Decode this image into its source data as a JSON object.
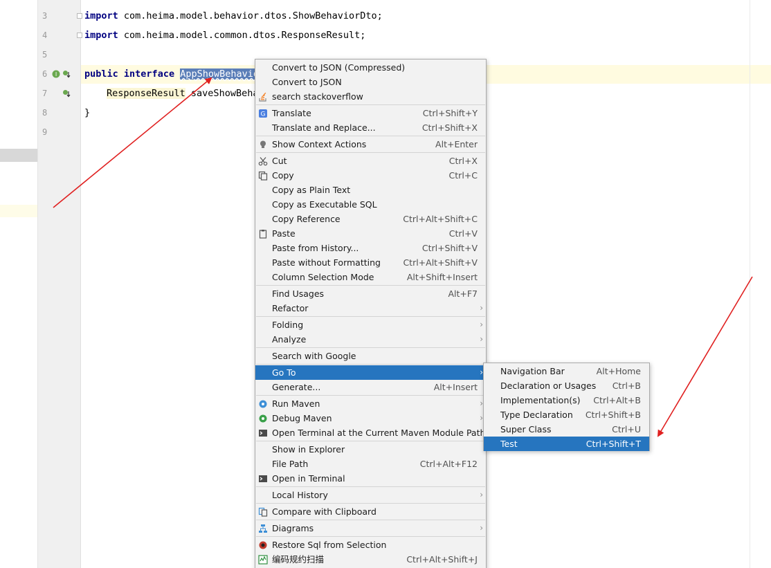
{
  "colors": {
    "keyword": "#000080",
    "selection": "#5b7eb8",
    "menu_active": "#2675bf",
    "annotation_arrow": "#e02020"
  },
  "gutter": {
    "line_numbers": [
      "3",
      "4",
      "5",
      "6",
      "7",
      "8",
      "9"
    ]
  },
  "editor": {
    "lines": {
      "l3": {
        "kw": "import",
        "rest": " com.heima.model.behavior.dtos.ShowBehaviorDto;"
      },
      "l4": {
        "kw": "import",
        "rest": " com.heima.model.common.dtos.ResponseResult;"
      },
      "l6": {
        "kw1": "public",
        "kw2": "interface",
        "name": "AppShowBehavio"
      },
      "l7": {
        "type": "ResponseResult",
        "rest": " saveShowBeha"
      },
      "l8": {
        "text": "}"
      }
    }
  },
  "context_menu": {
    "items": [
      {
        "label": "Convert to JSON (Compressed)",
        "shortcut": ""
      },
      {
        "label": "Convert to JSON",
        "shortcut": ""
      },
      {
        "label": "search stackoverflow",
        "shortcut": "",
        "icon": "stackoverflow-icon"
      },
      {
        "label": "Translate",
        "shortcut": "Ctrl+Shift+Y",
        "icon": "translate-icon"
      },
      {
        "label": "Translate and Replace...",
        "shortcut": "Ctrl+Shift+X"
      },
      {
        "label": "Show Context Actions",
        "shortcut": "Alt+Enter",
        "icon": "lightbulb-icon"
      },
      {
        "label": "Cut",
        "shortcut": "Ctrl+X",
        "icon": "scissors-icon"
      },
      {
        "label": "Copy",
        "shortcut": "Ctrl+C",
        "icon": "copy-icon"
      },
      {
        "label": "Copy as Plain Text",
        "shortcut": ""
      },
      {
        "label": "Copy as Executable SQL",
        "shortcut": ""
      },
      {
        "label": "Copy Reference",
        "shortcut": "Ctrl+Alt+Shift+C"
      },
      {
        "label": "Paste",
        "shortcut": "Ctrl+V",
        "icon": "clipboard-icon"
      },
      {
        "label": "Paste from History...",
        "shortcut": "Ctrl+Shift+V"
      },
      {
        "label": "Paste without Formatting",
        "shortcut": "Ctrl+Alt+Shift+V"
      },
      {
        "label": "Column Selection Mode",
        "shortcut": "Alt+Shift+Insert"
      },
      {
        "label": "Find Usages",
        "shortcut": "Alt+F7"
      },
      {
        "label": "Refactor",
        "shortcut": ""
      },
      {
        "label": "Folding",
        "shortcut": ""
      },
      {
        "label": "Analyze",
        "shortcut": ""
      },
      {
        "label": "Search with Google",
        "shortcut": ""
      },
      {
        "label": "Go To",
        "shortcut": ""
      },
      {
        "label": "Generate...",
        "shortcut": "Alt+Insert"
      },
      {
        "label": "Run Maven",
        "shortcut": "",
        "icon": "gear-run-icon"
      },
      {
        "label": "Debug Maven",
        "shortcut": "",
        "icon": "gear-debug-icon"
      },
      {
        "label": "Open Terminal at the Current Maven Module Path",
        "shortcut": "",
        "icon": "terminal-icon"
      },
      {
        "label": "Show in Explorer",
        "shortcut": ""
      },
      {
        "label": "File Path",
        "shortcut": "Ctrl+Alt+F12"
      },
      {
        "label": "Open in Terminal",
        "shortcut": "",
        "icon": "terminal-icon"
      },
      {
        "label": "Local History",
        "shortcut": ""
      },
      {
        "label": "Compare with Clipboard",
        "shortcut": "",
        "icon": "compare-icon"
      },
      {
        "label": "Diagrams",
        "shortcut": "",
        "icon": "diagram-icon"
      },
      {
        "label": "Restore Sql from Selection",
        "shortcut": "",
        "icon": "restore-sql-icon"
      },
      {
        "label": "编码规约扫描",
        "shortcut": "Ctrl+Alt+Shift+J",
        "icon": "scan-icon"
      }
    ]
  },
  "submenu": {
    "items": [
      {
        "label": "Navigation Bar",
        "shortcut": "Alt+Home"
      },
      {
        "label": "Declaration or Usages",
        "shortcut": "Ctrl+B"
      },
      {
        "label": "Implementation(s)",
        "shortcut": "Ctrl+Alt+B"
      },
      {
        "label": "Type Declaration",
        "shortcut": "Ctrl+Shift+B"
      },
      {
        "label": "Super Class",
        "shortcut": "Ctrl+U"
      },
      {
        "label": "Test",
        "shortcut": "Ctrl+Shift+T"
      }
    ]
  }
}
